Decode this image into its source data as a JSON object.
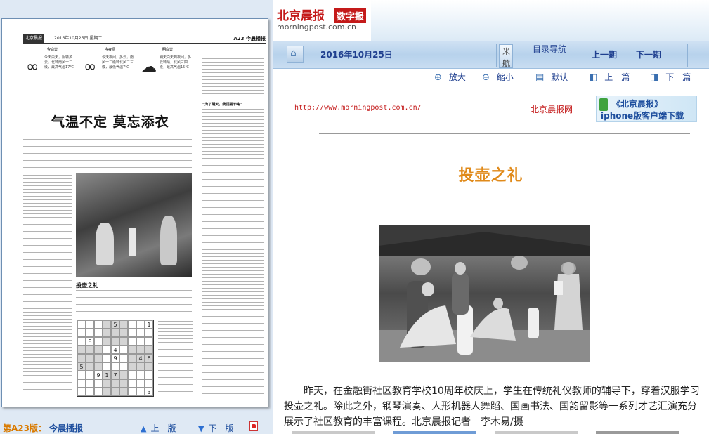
{
  "newspaper": {
    "section_label": "北京晨报",
    "date_small": "2016年10月25日 星期二",
    "page_label": "A23 今晨播报",
    "weather": [
      {
        "day": "今白天",
        "text": "今天白天，阴转多云，北转南风一二级，最高气温17℃"
      },
      {
        "day": "今夜间",
        "text": "今天夜间，多云，南风一二级转北风二三级，最低气温7℃"
      },
      {
        "day": "明白天",
        "text": "明天白天到夜间，多云转晴，北风三四级，最高气温15℃"
      }
    ],
    "headline": "气温不定 莫忘添衣",
    "photo_caption_title": "投壶之礼",
    "right_column_heading": "“为了明天，我们要干啥”",
    "sudoku": [
      "",
      "",
      "",
      "",
      "5",
      "",
      "",
      "",
      "1",
      "",
      "",
      "",
      "",
      "",
      "",
      "",
      "",
      "",
      "",
      "8",
      "",
      "",
      "",
      "",
      "",
      "",
      "",
      "",
      "",
      "",
      "",
      "4",
      "",
      "",
      "",
      "",
      "",
      "",
      "",
      "",
      "9",
      "",
      "",
      "4",
      "6",
      "5",
      "",
      "",
      "",
      "",
      "",
      "",
      "",
      "",
      "",
      "",
      "9",
      "1",
      "7",
      "",
      "",
      "",
      "",
      "",
      "",
      "",
      "",
      "",
      "",
      "",
      "",
      "",
      "",
      "",
      "",
      "",
      "",
      "",
      "",
      "",
      "3"
    ]
  },
  "page_nav": {
    "edition": "第A23版：",
    "page_name": "今晨播报",
    "prev": "上一版",
    "next": "下一版"
  },
  "header": {
    "logo_cn": "北京晨报",
    "logo_tag": "数字报",
    "logo_url": "morningpost.com.cn"
  },
  "toolbar": {
    "date": "2016年10月25日",
    "nav_label": "目录导航",
    "nav_glyph_top": "米",
    "nav_glyph_bottom": "航",
    "prev_issue": "上一期",
    "next_issue": "下一期"
  },
  "tools": {
    "zoom_in": "放大",
    "zoom_out": "缩小",
    "default": "默认",
    "prev_article": "上一篇",
    "next_article": "下一篇"
  },
  "article": {
    "source_url": "http://www.morningpost.com.cn/",
    "site_name": "北京晨报网",
    "banner_line1": "《北京晨报》",
    "banner_line2": "iphone版客户端下载",
    "title": "投壶之礼",
    "body": "昨天，在金融街社区教育学校10周年校庆上，学生在传统礼仪教师的辅导下，穿着汉服学习投壶之礼。除此之外，钢琴演奏、人形机器人舞蹈、国画书法、国韵留影等一系列才艺汇演充分展示了社区教育的丰富课程。北京晨报记者　李木易/摄"
  },
  "colors": {
    "brand_red": "#c41a1a",
    "title_orange": "#e08a1a",
    "nav_blue": "#1f3f8f",
    "edition_orange": "#d97a00"
  }
}
